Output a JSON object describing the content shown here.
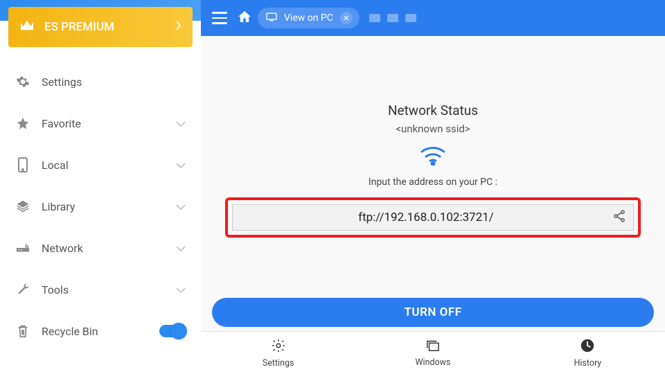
{
  "premium_label": "ES PREMIUM",
  "sidebar": {
    "items": [
      {
        "label": "Settings"
      },
      {
        "label": "Favorite"
      },
      {
        "label": "Local"
      },
      {
        "label": "Library"
      },
      {
        "label": "Network"
      },
      {
        "label": "Tools"
      },
      {
        "label": "Recycle Bin"
      }
    ]
  },
  "tab": {
    "label": "View on PC"
  },
  "network": {
    "title": "Network Status",
    "ssid": "<unknown ssid>",
    "prompt": "Input the address on your PC :",
    "address": "ftp://192.168.0.102:3721/"
  },
  "turnoff_label": "TURN OFF",
  "bottom": {
    "settings": "Settings",
    "windows": "Windows",
    "history": "History"
  }
}
